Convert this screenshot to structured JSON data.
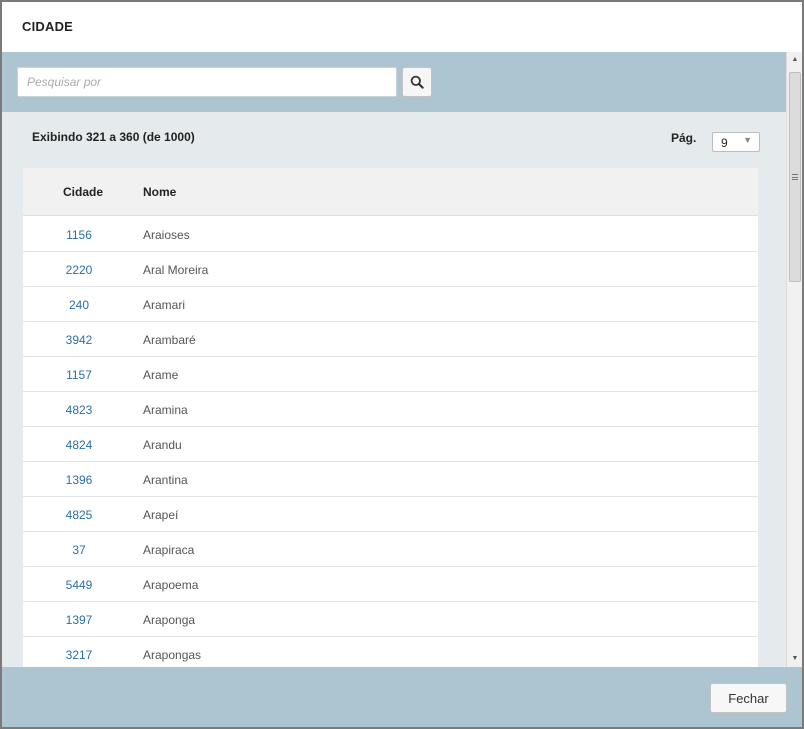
{
  "dialog": {
    "title": "CIDADE"
  },
  "search": {
    "placeholder": "Pesquisar por",
    "value": "",
    "button_icon": "search-icon"
  },
  "pagination": {
    "showing_text": "Exibindo 321 a 360 (de 1000)",
    "page_label": "Pág.",
    "page_value": "9",
    "select_icon": "caret-down-icon"
  },
  "table": {
    "columns": [
      "Cidade",
      "Nome"
    ],
    "rows": [
      {
        "code": "1156",
        "name": "Araioses"
      },
      {
        "code": "2220",
        "name": "Aral Moreira"
      },
      {
        "code": "240",
        "name": "Aramari"
      },
      {
        "code": "3942",
        "name": "Arambaré"
      },
      {
        "code": "1157",
        "name": "Arame"
      },
      {
        "code": "4823",
        "name": "Aramina"
      },
      {
        "code": "4824",
        "name": "Arandu"
      },
      {
        "code": "1396",
        "name": "Arantina"
      },
      {
        "code": "4825",
        "name": "Arapeí"
      },
      {
        "code": "37",
        "name": "Arapiraca"
      },
      {
        "code": "5449",
        "name": "Arapoema"
      },
      {
        "code": "1397",
        "name": "Araponga"
      },
      {
        "code": "3217",
        "name": "Arapongas"
      }
    ]
  },
  "footer": {
    "close_label": "Fechar"
  },
  "colors": {
    "bar_background": "#adc4d1",
    "content_background": "#e5eaed",
    "link_code": "#2a6fa6"
  }
}
